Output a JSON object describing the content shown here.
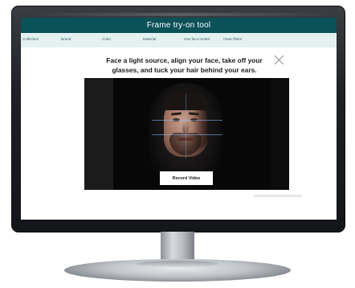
{
  "app": {
    "title": "Frame try-on tool"
  },
  "filters": [
    {
      "label": "Collection"
    },
    {
      "label": "Brand"
    },
    {
      "label": "Color"
    },
    {
      "label": "Material"
    },
    {
      "label": "Use face model"
    },
    {
      "label": "Clear filters"
    }
  ],
  "overlay": {
    "instruction": "Face a light source, align your face, take off your glasses, and tuck your hair behind your ears.",
    "record_label": "Record Video",
    "close_icon": "close-icon"
  },
  "colors": {
    "header": "#0b5158",
    "filter_bar": "#e4f1f1"
  }
}
